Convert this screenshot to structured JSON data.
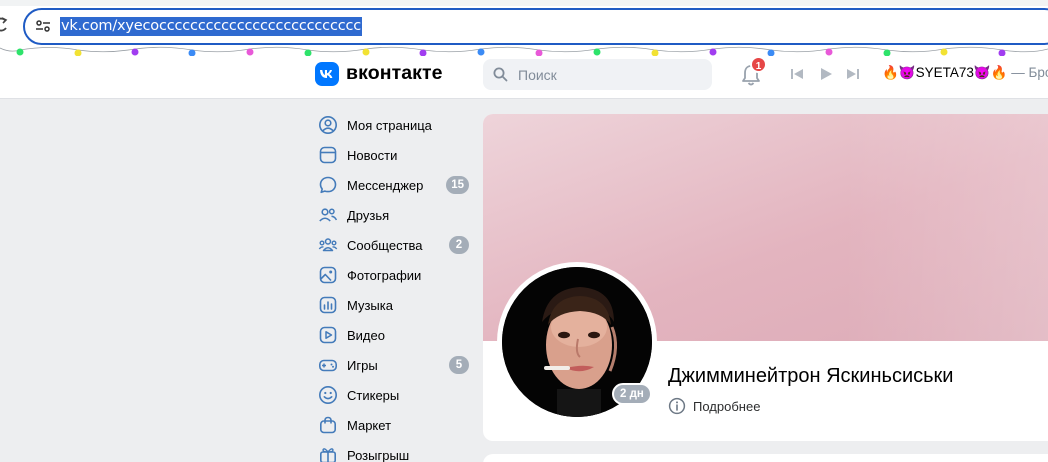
{
  "browser": {
    "url": "vk.com/xyecocccccccccccccccccccccccccc"
  },
  "header": {
    "logo_text": "вконтакте",
    "search_placeholder": "Поиск",
    "notifications_count": "1",
    "now_playing": {
      "prefix_emoji": "🔥👿",
      "artist": "SYETA73",
      "suffix_emoji": "👿🔥",
      "separator": " — Бро"
    }
  },
  "menu": {
    "items": [
      {
        "label": "Моя страница",
        "icon": "user-circle-icon",
        "count": ""
      },
      {
        "label": "Новости",
        "icon": "news-icon",
        "count": ""
      },
      {
        "label": "Мессенджер",
        "icon": "message-icon",
        "count": "15"
      },
      {
        "label": "Друзья",
        "icon": "friends-icon",
        "count": ""
      },
      {
        "label": "Сообщества",
        "icon": "communities-icon",
        "count": "2"
      },
      {
        "label": "Фотографии",
        "icon": "photo-icon",
        "count": ""
      },
      {
        "label": "Музыка",
        "icon": "music-icon",
        "count": ""
      },
      {
        "label": "Видео",
        "icon": "video-icon",
        "count": ""
      },
      {
        "label": "Игры",
        "icon": "gamepad-icon",
        "count": "5"
      },
      {
        "label": "Стикеры",
        "icon": "smile-icon",
        "count": ""
      },
      {
        "label": "Маркет",
        "icon": "market-bag-icon",
        "count": ""
      },
      {
        "label": "Розыгрыш",
        "icon": "gift-icon",
        "count": ""
      }
    ]
  },
  "profile": {
    "name": "Джимминейтрон Яскиньсиськи",
    "last_seen": "2 дн",
    "details_label": "Подробнее"
  },
  "colors": {
    "vk_blue": "#0077ff",
    "badge_gray": "#a4adb8",
    "alert_red": "#e64646",
    "cover_pink": "#e3b4bf"
  }
}
